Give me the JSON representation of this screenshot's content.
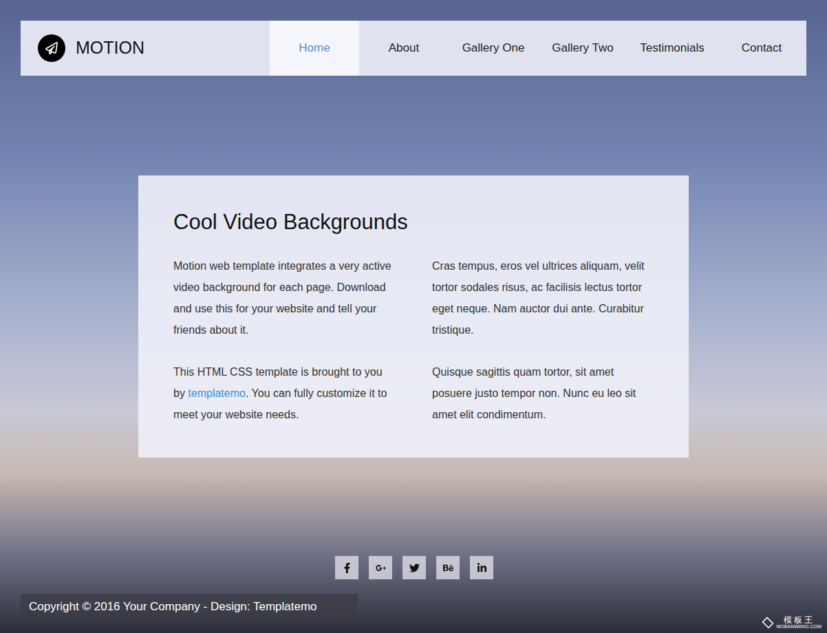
{
  "brand": {
    "name": "MOTION"
  },
  "nav": [
    {
      "label": "Home",
      "selected": true
    },
    {
      "label": "About",
      "selected": false
    },
    {
      "label": "Gallery One",
      "selected": false
    },
    {
      "label": "Gallery Two",
      "selected": false
    },
    {
      "label": "Testimonials",
      "selected": false
    },
    {
      "label": "Contact",
      "selected": false
    }
  ],
  "card": {
    "title": "Cool Video Backgrounds",
    "columns": [
      [
        [
          {
            "text": "Motion web template integrates a very active video background for each page. Download and use this for your website and tell your friends about it.",
            "link": false
          }
        ],
        [
          {
            "text": "This HTML CSS template is brought to you by ",
            "link": false
          },
          {
            "text": "templatemo",
            "link": true
          },
          {
            "text": ". You can fully customize it to meet your website needs.",
            "link": false
          }
        ]
      ],
      [
        [
          {
            "text": "Cras tempus, eros vel ultrices aliquam, velit tortor sodales risus, ac facilisis lectus tortor eget neque. Nam auctor dui ante. Curabitur tristique.",
            "link": false
          }
        ],
        [
          {
            "text": "Quisque sagittis quam tortor, sit amet posuere justo tempor non. Nunc eu leo sit amet elit condimentum.",
            "link": false
          }
        ]
      ]
    ]
  },
  "social": [
    {
      "kind": "facebook"
    },
    {
      "kind": "google-plus"
    },
    {
      "kind": "twitter"
    },
    {
      "kind": "behance"
    },
    {
      "kind": "linkedin"
    }
  ],
  "footer": {
    "copyright": "Copyright © 2016 Your Company - Design: Templatemo"
  },
  "watermark": {
    "title": "模板王",
    "url": "MOBANWANG.COM"
  }
}
